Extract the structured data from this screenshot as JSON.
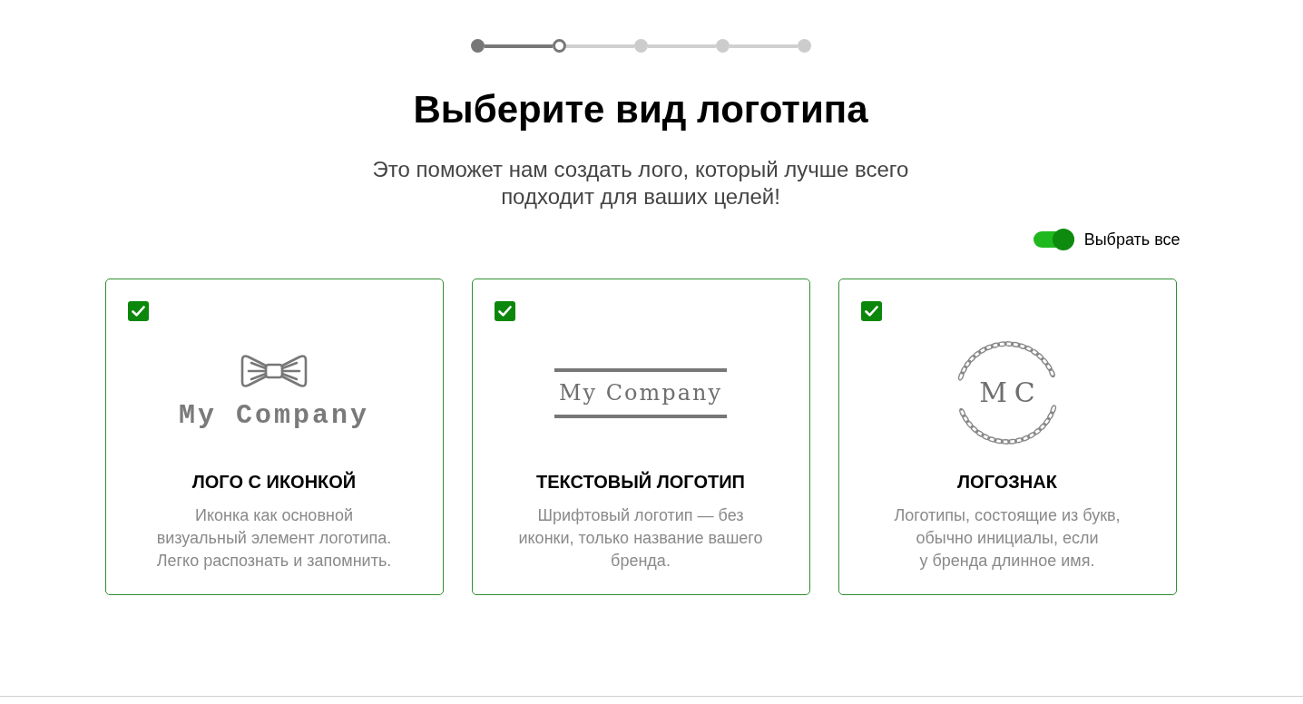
{
  "stepper": {
    "steps": [
      {
        "completed": true,
        "current": false
      },
      {
        "completed": false,
        "current": true
      },
      {
        "completed": false,
        "current": false
      },
      {
        "completed": false,
        "current": false
      },
      {
        "completed": false,
        "current": false
      }
    ]
  },
  "title": "Выберите вид логотипа",
  "subtitle": "Это поможет нам создать лого, который лучше всего\nподходит для ваших целей!",
  "select_all": {
    "label": "Выбрать все",
    "on": true
  },
  "cards": [
    {
      "checked": true,
      "preview": {
        "kind": "icon",
        "text": "My Company"
      },
      "title": "ЛОГО С ИКОНКОЙ",
      "description": "Иконка как основной\nвизуальный элемент логотипа.\nЛегко распознать и запомнить."
    },
    {
      "checked": true,
      "preview": {
        "kind": "text",
        "text": "My Company"
      },
      "title": "ТЕКСТОВЫЙ ЛОГОТИП",
      "description": "Шрифтовый логотип — без\nиконки, только название вашего\nбренда."
    },
    {
      "checked": true,
      "preview": {
        "kind": "monogram",
        "text": "MC"
      },
      "title": "ЛОГОЗНАК",
      "description": "Логотипы, состоящие из букв,\nобычно инициалы, если\nу бренда длинное имя."
    }
  ]
}
